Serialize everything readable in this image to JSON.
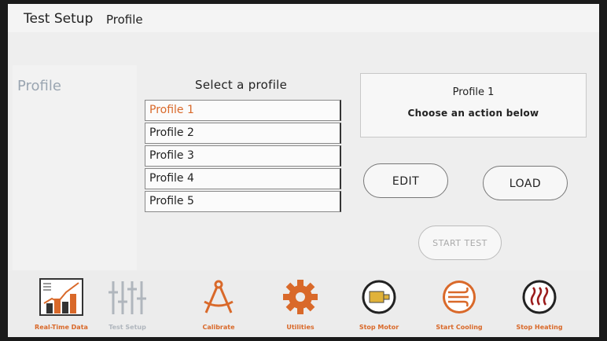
{
  "header": {
    "title": "Test Setup",
    "subtitle": "Profile"
  },
  "sidebar": {
    "label": "Profile"
  },
  "profiles": {
    "heading": "Select a profile",
    "items": [
      "Profile 1",
      "Profile 2",
      "Profile 3",
      "Profile 4",
      "Profile 5"
    ],
    "selected_index": 0
  },
  "info": {
    "title": "Profile 1",
    "subtitle": "Choose an action below"
  },
  "actions": {
    "edit": "EDIT",
    "load": "LOAD",
    "start": "START TEST"
  },
  "toolbar": {
    "items": [
      {
        "label": "Real-Time Data",
        "icon": "realtime-chart-icon"
      },
      {
        "label": "Test Setup",
        "icon": "sliders-icon"
      },
      {
        "label": "Calibrate",
        "icon": "compass-icon"
      },
      {
        "label": "Utilities",
        "icon": "gear-icon"
      },
      {
        "label": "Stop Motor",
        "icon": "motor-icon"
      },
      {
        "label": "Start Cooling",
        "icon": "cooling-icon"
      },
      {
        "label": "Stop Heating",
        "icon": "heating-icon"
      }
    ]
  },
  "colors": {
    "accent": "#d9692a",
    "dim": "#b0b6bd",
    "dark_red": "#9b1b1b"
  }
}
